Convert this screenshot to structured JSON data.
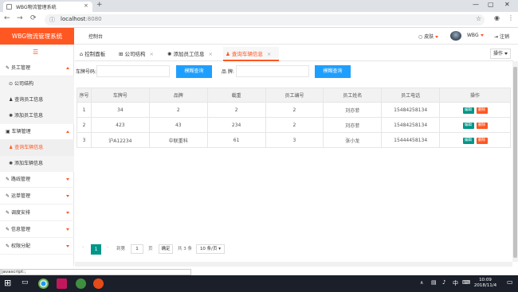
{
  "browser": {
    "tab_title": "WBG物流管理系统",
    "url_host": "localhost",
    "url_port": ":8080",
    "new_tab": "+",
    "close": "×"
  },
  "app": {
    "logo": "WBG物流管理系统",
    "header": {
      "console": "控制台",
      "skin": "皮肤",
      "user": "WBG",
      "logout": "注销"
    },
    "sidebar": {
      "items": [
        {
          "label": "员工管理",
          "type": "group"
        },
        {
          "label": "公司结构",
          "type": "sub"
        },
        {
          "label": "查询员工信息",
          "type": "sub"
        },
        {
          "label": "添加员工信息",
          "type": "sub"
        },
        {
          "label": "车辆管理",
          "type": "group"
        },
        {
          "label": "查询车辆信息",
          "type": "sub",
          "active": true
        },
        {
          "label": "添加车辆信息",
          "type": "sub"
        },
        {
          "label": "路线管理",
          "type": "group"
        },
        {
          "label": "运单管理",
          "type": "group"
        },
        {
          "label": "调度安排",
          "type": "group"
        },
        {
          "label": "信息管理",
          "type": "group"
        },
        {
          "label": "权限分配",
          "type": "group"
        }
      ]
    },
    "tabs": [
      {
        "label": "控制面板",
        "icon": "home-icon"
      },
      {
        "label": "公司结构",
        "icon": "sitemap-icon"
      },
      {
        "label": "添加员工信息",
        "icon": "gear-icon"
      },
      {
        "label": "查询车辆信息",
        "icon": "car-icon",
        "active": true
      }
    ],
    "ops_label": "操作",
    "search": {
      "plate_label": "车牌号码:",
      "brand_label": "品 牌:",
      "button": "模糊查询"
    },
    "table": {
      "headers": [
        "序号",
        "车牌号",
        "品牌",
        "载重",
        "员工编号",
        "员工姓名",
        "员工电话",
        "操作"
      ],
      "rows": [
        [
          "1",
          "34",
          "2",
          "2",
          "2",
          "刘亦菲",
          "15484258134"
        ],
        [
          "2",
          "423",
          "43",
          "234",
          "2",
          "刘亦菲",
          "15484258134"
        ],
        [
          "3",
          "沪A12234",
          "中联重科",
          "61",
          "3",
          "张小龙",
          "15444458134"
        ]
      ],
      "edit": "编辑",
      "delete": "删除"
    },
    "pagination": {
      "current": "1",
      "goto_pre": "到第",
      "goto_value": "1",
      "goto_post": "页",
      "confirm": "确定",
      "total": "共 3 条",
      "page_size": "10 条/页"
    }
  },
  "status_bar": "javascript:;",
  "taskbar": {
    "time": "10:09",
    "date": "2018/11/4"
  }
}
